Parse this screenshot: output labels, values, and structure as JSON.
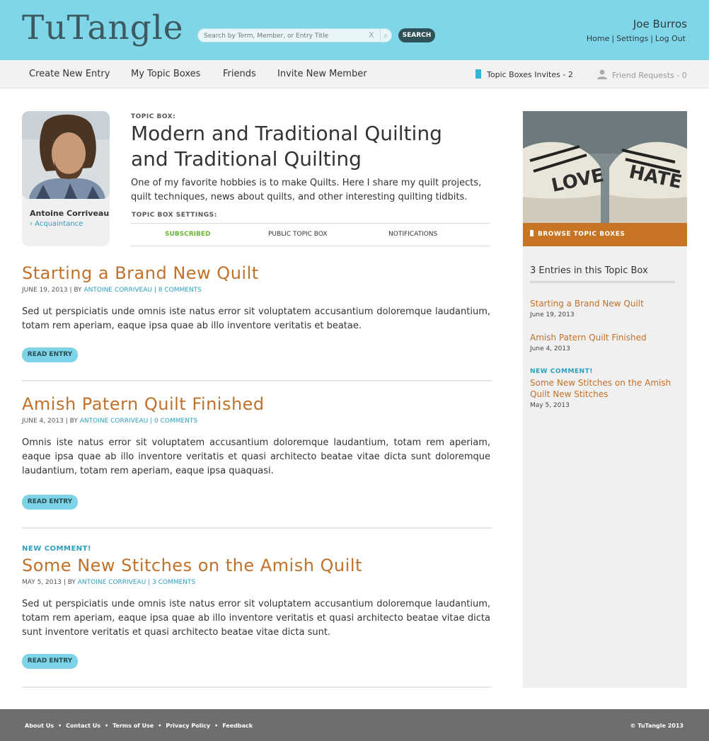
{
  "header": {
    "logo": "TuTangle",
    "search_placeholder": "Search by Term, Member, or Entry Title",
    "search_clear": "X",
    "search_button": "SEARCH",
    "user_name": "Joe Burros",
    "links": [
      "Home",
      "Settings",
      "Log Out"
    ]
  },
  "nav": {
    "items": [
      "Create New Entry",
      "My Topic Boxes",
      "Friends",
      "Invite New Member"
    ],
    "topic_box_invites": "Topic Boxes Invites - 2",
    "friend_requests": "Friend Requests - 0"
  },
  "profile": {
    "name": "Antoine Corriveau",
    "relation": "› Acquaintance"
  },
  "topic_box": {
    "label": "TOPIC BOX:",
    "title": "Modern and Traditional Quilting and Traditional Quilting",
    "description": "One of my favorite hobbies is to make Quilts. Here I share my quilt projects, quilt techniques, news about quilts, and other interesting quilting tidbits.",
    "settings_label": "TOPIC BOX SETTINGS:",
    "settings": [
      "SUBSCRIBED",
      "PUBLIC TOPIC BOX",
      "NOTIFICATIONS"
    ]
  },
  "entries": [
    {
      "new_label": "",
      "title": "Starting a Brand New Quilt",
      "date": "JUNE 19, 2013",
      "by": "| BY",
      "author": "ANTOINE CORRIVEAU",
      "sep": "|",
      "comments": "8 COMMENTS",
      "body": "Sed ut perspiciatis unde omnis iste natus error sit voluptatem accusantium doloremque laudantium, totam rem aperiam, eaque ipsa quae ab illo inventore veritatis et beatae.",
      "button": "READ ENTRY"
    },
    {
      "new_label": "",
      "title": "Amish Patern Quilt Finished",
      "date": "JUNE 4, 2013",
      "by": "| BY",
      "author": "ANTOINE CORRIVEAU",
      "sep": "|",
      "comments": "0 COMMENTS",
      "body": "Omnis iste natus error sit voluptatem accusantium doloremque laudantium, totam rem aperiam, eaque ipsa quae ab illo inventore veritatis et quasi architecto beatae vitae dicta sunt doloremque laudantium, totam rem aperiam, eaque ipsa quaquasi.",
      "button": "READ ENTRY"
    },
    {
      "new_label": "NEW COMMENT!",
      "title": "Some New Stitches on the Amish Quilt",
      "date": "MAY 5, 2013",
      "by": "| BY",
      "author": "ANTOINE CORRIVEAU",
      "sep": "|",
      "comments": "3 COMMENTS",
      "body": "Sed ut perspiciatis unde omnis iste natus error sit voluptatem accusantium doloremque laudantium, totam rem aperiam, eaque ipsa quae ab illo inventore veritatis et quasi architecto beatae vitae dicta sunt inventore veritatis et quasi architecto beatae vitae dicta sunt.",
      "button": "READ ENTRY"
    }
  ],
  "sidebar": {
    "browse_label": "BROWSE TOPIC BOXES",
    "photo_words": [
      "LOVE",
      "HATE"
    ],
    "heading": "3 Entries in this Topic Box",
    "items": [
      {
        "new_label": "",
        "title": "Starting a Brand New Quilt",
        "date": "June 19, 2013"
      },
      {
        "new_label": "",
        "title": "Amish Patern Quilt Finished",
        "date": "June 4, 2013"
      },
      {
        "new_label": "NEW COMMENT!",
        "title": "Some New Stitches on the Amish Quilt New Stitches",
        "date": "May 5, 2013"
      }
    ]
  },
  "footer": {
    "links": [
      "About Us",
      "Contact Us",
      "Terms of Use",
      "Privacy Policy",
      "Feedback"
    ],
    "copyright": "© TuTangle 2013"
  },
  "colors": {
    "header_bg": "#7fd6e8",
    "accent_orange": "#c0712a",
    "link_blue": "#2a9fbf",
    "subscribed_green": "#6bb53a",
    "button_bg": "#7dd3e8",
    "footer_bg": "#6e6e6e"
  }
}
